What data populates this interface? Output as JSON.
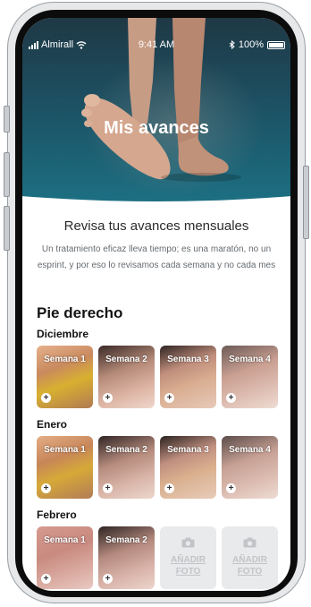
{
  "status_bar": {
    "carrier": "Almirall",
    "time": "9:41 AM",
    "battery": "100%"
  },
  "hero": {
    "title": "Mis avances"
  },
  "intro": {
    "subtitle": "Revisa tus avances mensuales",
    "description": "Un tratamiento eficaz lleva tiempo; es una maratón, no un esprint, y por eso lo revisamos cada semana y no cada mes"
  },
  "section": {
    "title": "Pie derecho"
  },
  "months": [
    {
      "name": "Diciembre",
      "slots": [
        {
          "type": "photo",
          "label": "Semana 1"
        },
        {
          "type": "photo",
          "label": "Semana 2"
        },
        {
          "type": "photo",
          "label": "Semana 3"
        },
        {
          "type": "photo",
          "label": "Semana 4"
        }
      ]
    },
    {
      "name": "Enero",
      "slots": [
        {
          "type": "photo",
          "label": "Semana 1"
        },
        {
          "type": "photo",
          "label": "Semana 2"
        },
        {
          "type": "photo",
          "label": "Semana 3"
        },
        {
          "type": "photo",
          "label": "Semana 4"
        }
      ]
    },
    {
      "name": "Febrero",
      "slots": [
        {
          "type": "photo",
          "label": "Semana 1"
        },
        {
          "type": "photo",
          "label": "Semana 2"
        },
        {
          "type": "add",
          "label": "AÑADIR FOTO"
        },
        {
          "type": "add",
          "label": "AÑADIR FOTO"
        }
      ]
    }
  ],
  "icons": {
    "signal": "signal-bars-icon",
    "wifi": "wifi-icon",
    "bluetooth": "bluetooth-icon",
    "battery": "battery-icon",
    "add": "plus-circle-icon",
    "camera": "camera-icon"
  },
  "colors": {
    "hero_top": "#1f3845",
    "hero_bottom": "#1d6f82",
    "add_photo_bg": "#e9eaec",
    "add_photo_text": "#c2c4c7"
  }
}
